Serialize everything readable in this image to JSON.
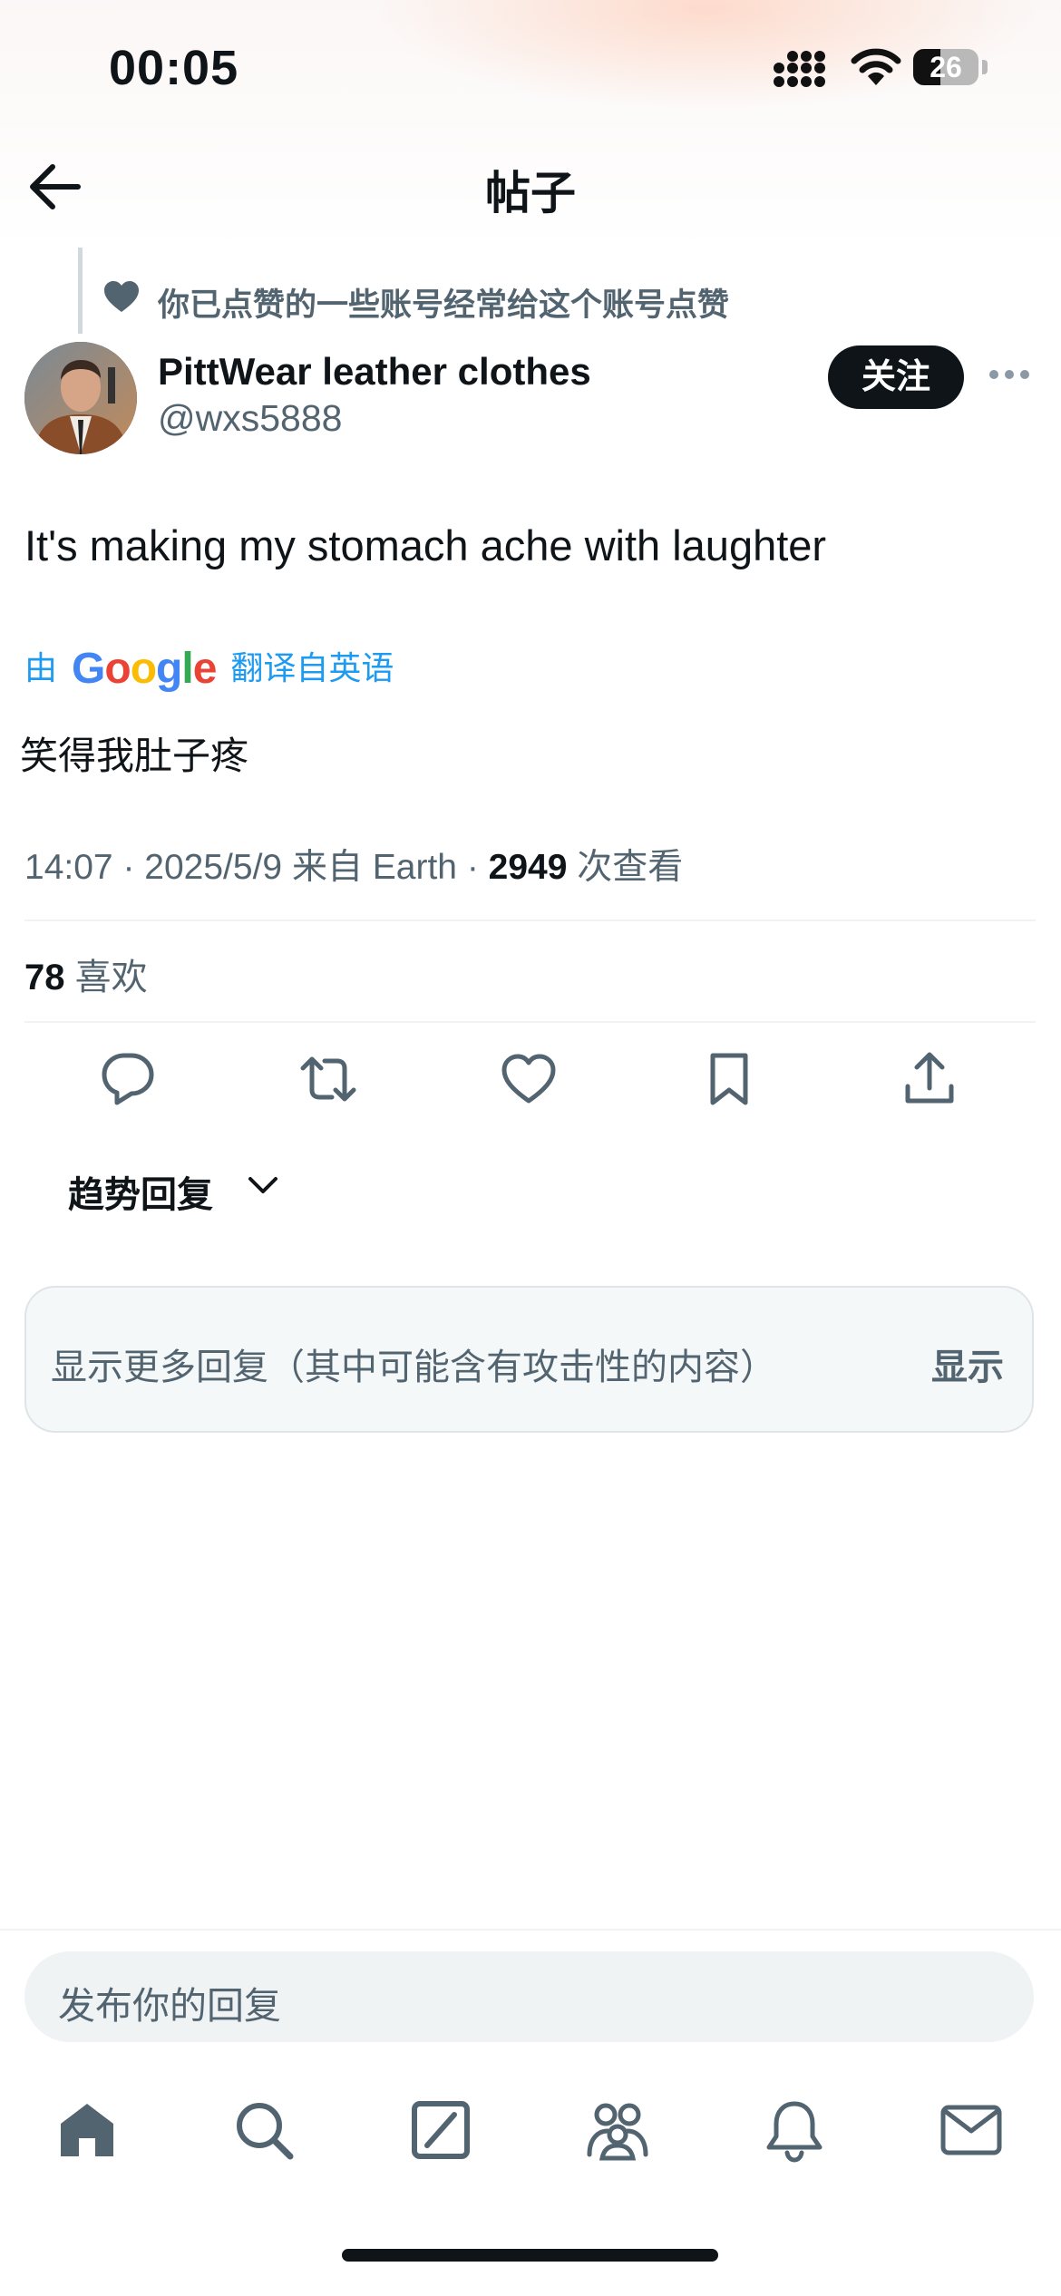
{
  "status": {
    "time": "00:05",
    "battery": "26"
  },
  "header": {
    "title": "帖子"
  },
  "social_context": "你已点赞的一些账号经常给这个账号点赞",
  "author": {
    "name": "PittWear leather clothes",
    "handle": "@wxs5888",
    "follow_label": "关注"
  },
  "tweet": {
    "text": "It's making my stomach ache with laughter"
  },
  "translation": {
    "prefix": "由",
    "brand": "Google",
    "suffix": "翻译自英语",
    "text": "笑得我肚子疼"
  },
  "meta": {
    "time": "14:07",
    "date": "2025/5/9",
    "source": "来自 Earth",
    "views": "2949",
    "views_label": "次查看"
  },
  "likes": {
    "count": "78",
    "label": "喜欢"
  },
  "trending": {
    "label": "趋势回复"
  },
  "more_replies": {
    "text": "显示更多回复（其中可能含有攻击性的内容）",
    "action": "显示"
  },
  "composer": {
    "placeholder": "发布你的回复"
  },
  "icons": {
    "actions": [
      "reply-icon",
      "retweet-icon",
      "like-icon",
      "bookmark-icon",
      "share-icon"
    ],
    "nav": [
      "home-icon",
      "search-icon",
      "grok-icon",
      "communities-icon",
      "notifications-icon",
      "messages-icon"
    ]
  },
  "colors": {
    "text": "#0f1419",
    "secondary": "#536471",
    "link": "#1d9bf0",
    "button": "#0f1419"
  }
}
